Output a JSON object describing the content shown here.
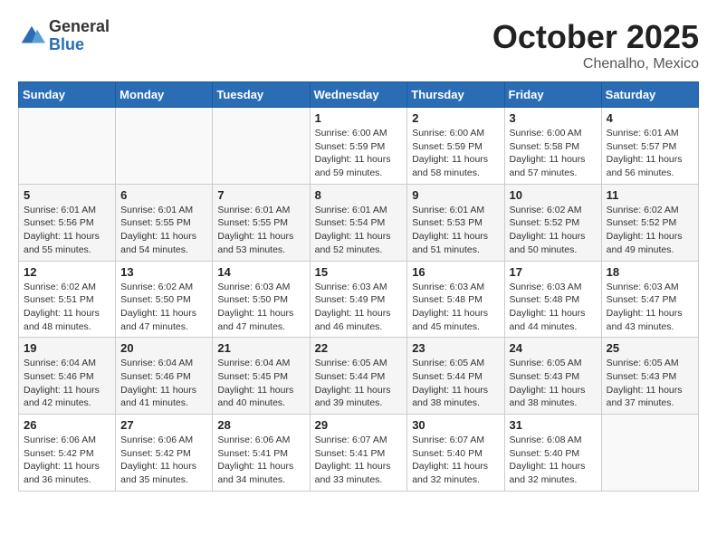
{
  "header": {
    "logo_general": "General",
    "logo_blue": "Blue",
    "month": "October 2025",
    "location": "Chenalho, Mexico"
  },
  "weekdays": [
    "Sunday",
    "Monday",
    "Tuesday",
    "Wednesday",
    "Thursday",
    "Friday",
    "Saturday"
  ],
  "weeks": [
    [
      {
        "day": "",
        "info": ""
      },
      {
        "day": "",
        "info": ""
      },
      {
        "day": "",
        "info": ""
      },
      {
        "day": "1",
        "info": "Sunrise: 6:00 AM\nSunset: 5:59 PM\nDaylight: 11 hours\nand 59 minutes."
      },
      {
        "day": "2",
        "info": "Sunrise: 6:00 AM\nSunset: 5:59 PM\nDaylight: 11 hours\nand 58 minutes."
      },
      {
        "day": "3",
        "info": "Sunrise: 6:00 AM\nSunset: 5:58 PM\nDaylight: 11 hours\nand 57 minutes."
      },
      {
        "day": "4",
        "info": "Sunrise: 6:01 AM\nSunset: 5:57 PM\nDaylight: 11 hours\nand 56 minutes."
      }
    ],
    [
      {
        "day": "5",
        "info": "Sunrise: 6:01 AM\nSunset: 5:56 PM\nDaylight: 11 hours\nand 55 minutes."
      },
      {
        "day": "6",
        "info": "Sunrise: 6:01 AM\nSunset: 5:55 PM\nDaylight: 11 hours\nand 54 minutes."
      },
      {
        "day": "7",
        "info": "Sunrise: 6:01 AM\nSunset: 5:55 PM\nDaylight: 11 hours\nand 53 minutes."
      },
      {
        "day": "8",
        "info": "Sunrise: 6:01 AM\nSunset: 5:54 PM\nDaylight: 11 hours\nand 52 minutes."
      },
      {
        "day": "9",
        "info": "Sunrise: 6:01 AM\nSunset: 5:53 PM\nDaylight: 11 hours\nand 51 minutes."
      },
      {
        "day": "10",
        "info": "Sunrise: 6:02 AM\nSunset: 5:52 PM\nDaylight: 11 hours\nand 50 minutes."
      },
      {
        "day": "11",
        "info": "Sunrise: 6:02 AM\nSunset: 5:52 PM\nDaylight: 11 hours\nand 49 minutes."
      }
    ],
    [
      {
        "day": "12",
        "info": "Sunrise: 6:02 AM\nSunset: 5:51 PM\nDaylight: 11 hours\nand 48 minutes."
      },
      {
        "day": "13",
        "info": "Sunrise: 6:02 AM\nSunset: 5:50 PM\nDaylight: 11 hours\nand 47 minutes."
      },
      {
        "day": "14",
        "info": "Sunrise: 6:03 AM\nSunset: 5:50 PM\nDaylight: 11 hours\nand 47 minutes."
      },
      {
        "day": "15",
        "info": "Sunrise: 6:03 AM\nSunset: 5:49 PM\nDaylight: 11 hours\nand 46 minutes."
      },
      {
        "day": "16",
        "info": "Sunrise: 6:03 AM\nSunset: 5:48 PM\nDaylight: 11 hours\nand 45 minutes."
      },
      {
        "day": "17",
        "info": "Sunrise: 6:03 AM\nSunset: 5:48 PM\nDaylight: 11 hours\nand 44 minutes."
      },
      {
        "day": "18",
        "info": "Sunrise: 6:03 AM\nSunset: 5:47 PM\nDaylight: 11 hours\nand 43 minutes."
      }
    ],
    [
      {
        "day": "19",
        "info": "Sunrise: 6:04 AM\nSunset: 5:46 PM\nDaylight: 11 hours\nand 42 minutes."
      },
      {
        "day": "20",
        "info": "Sunrise: 6:04 AM\nSunset: 5:46 PM\nDaylight: 11 hours\nand 41 minutes."
      },
      {
        "day": "21",
        "info": "Sunrise: 6:04 AM\nSunset: 5:45 PM\nDaylight: 11 hours\nand 40 minutes."
      },
      {
        "day": "22",
        "info": "Sunrise: 6:05 AM\nSunset: 5:44 PM\nDaylight: 11 hours\nand 39 minutes."
      },
      {
        "day": "23",
        "info": "Sunrise: 6:05 AM\nSunset: 5:44 PM\nDaylight: 11 hours\nand 38 minutes."
      },
      {
        "day": "24",
        "info": "Sunrise: 6:05 AM\nSunset: 5:43 PM\nDaylight: 11 hours\nand 38 minutes."
      },
      {
        "day": "25",
        "info": "Sunrise: 6:05 AM\nSunset: 5:43 PM\nDaylight: 11 hours\nand 37 minutes."
      }
    ],
    [
      {
        "day": "26",
        "info": "Sunrise: 6:06 AM\nSunset: 5:42 PM\nDaylight: 11 hours\nand 36 minutes."
      },
      {
        "day": "27",
        "info": "Sunrise: 6:06 AM\nSunset: 5:42 PM\nDaylight: 11 hours\nand 35 minutes."
      },
      {
        "day": "28",
        "info": "Sunrise: 6:06 AM\nSunset: 5:41 PM\nDaylight: 11 hours\nand 34 minutes."
      },
      {
        "day": "29",
        "info": "Sunrise: 6:07 AM\nSunset: 5:41 PM\nDaylight: 11 hours\nand 33 minutes."
      },
      {
        "day": "30",
        "info": "Sunrise: 6:07 AM\nSunset: 5:40 PM\nDaylight: 11 hours\nand 32 minutes."
      },
      {
        "day": "31",
        "info": "Sunrise: 6:08 AM\nSunset: 5:40 PM\nDaylight: 11 hours\nand 32 minutes."
      },
      {
        "day": "",
        "info": ""
      }
    ]
  ]
}
